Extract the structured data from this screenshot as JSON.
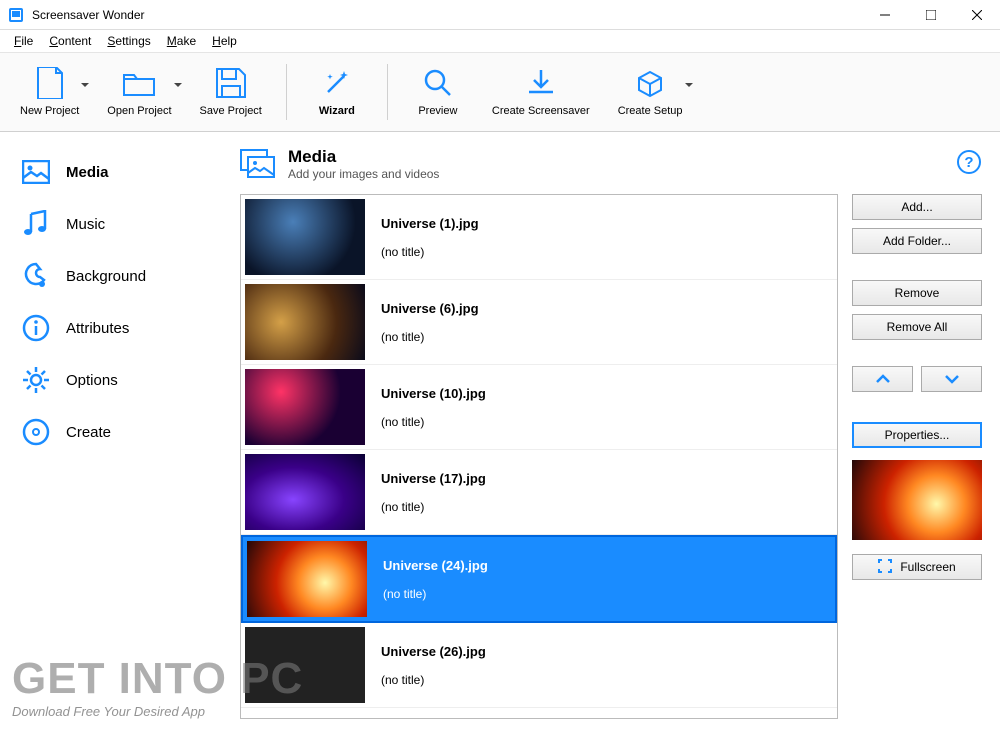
{
  "window": {
    "title": "Screensaver Wonder"
  },
  "menu": {
    "file": "File",
    "content": "Content",
    "settings": "Settings",
    "make": "Make",
    "help": "Help"
  },
  "toolbar": {
    "new": "New Project",
    "open": "Open Project",
    "save": "Save Project",
    "wizard": "Wizard",
    "preview": "Preview",
    "create_ss": "Create Screensaver",
    "create_setup": "Create Setup"
  },
  "sidebar": {
    "media": "Media",
    "music": "Music",
    "background": "Background",
    "attributes": "Attributes",
    "options": "Options",
    "create": "Create"
  },
  "content": {
    "title": "Media",
    "subtitle": "Add your images and videos",
    "items": [
      {
        "name": "Universe (1).jpg",
        "title": "(no title)"
      },
      {
        "name": "Universe (6).jpg",
        "title": "(no title)"
      },
      {
        "name": "Universe (10).jpg",
        "title": "(no title)"
      },
      {
        "name": "Universe (17).jpg",
        "title": "(no title)"
      },
      {
        "name": "Universe (24).jpg",
        "title": "(no title)"
      },
      {
        "name": "Universe (26).jpg",
        "title": "(no title)"
      }
    ]
  },
  "rpanel": {
    "add": "Add...",
    "add_folder": "Add Folder...",
    "remove": "Remove",
    "remove_all": "Remove All",
    "properties": "Properties...",
    "fullscreen": "Fullscreen"
  },
  "watermark": {
    "big": "GET INTO PC",
    "small": "Download Free Your Desired App"
  }
}
